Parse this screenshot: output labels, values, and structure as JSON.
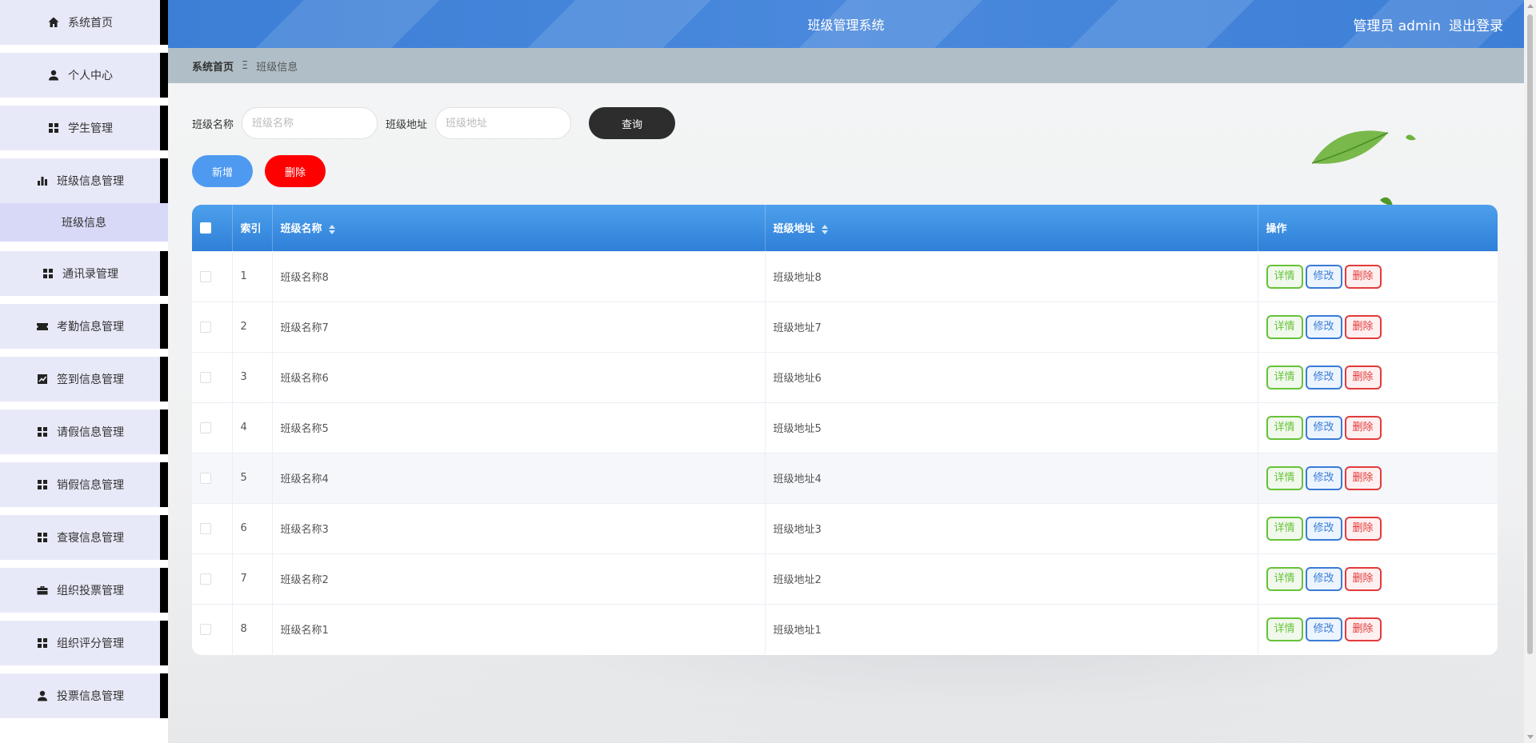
{
  "sidebar": {
    "items": [
      {
        "label": "系统首页",
        "icon": "home-icon"
      },
      {
        "label": "个人中心",
        "icon": "user-icon"
      },
      {
        "label": "学生管理",
        "icon": "grid-icon"
      },
      {
        "label": "班级信息管理",
        "icon": "bar-chart-icon"
      },
      {
        "label": "通讯录管理",
        "icon": "grid-icon"
      },
      {
        "label": "考勤信息管理",
        "icon": "ticket-icon"
      },
      {
        "label": "签到信息管理",
        "icon": "line-chart-icon"
      },
      {
        "label": "请假信息管理",
        "icon": "grid-icon"
      },
      {
        "label": "销假信息管理",
        "icon": "grid-icon"
      },
      {
        "label": "查寝信息管理",
        "icon": "grid-icon"
      },
      {
        "label": "组织投票管理",
        "icon": "briefcase-icon"
      },
      {
        "label": "组织评分管理",
        "icon": "grid-icon"
      },
      {
        "label": "投票信息管理",
        "icon": "user-icon"
      }
    ],
    "subitem": {
      "label": "班级信息"
    }
  },
  "header": {
    "title": "班级管理系统",
    "user": "管理员 admin",
    "logout": "退出登录"
  },
  "breadcrumb": {
    "home": "系统首页",
    "separator": "Ξ",
    "current": "班级信息"
  },
  "search": {
    "name_label": "班级名称",
    "name_placeholder": "班级名称",
    "address_label": "班级地址",
    "address_placeholder": "班级地址",
    "query_button": "查询"
  },
  "actions": {
    "add": "新增",
    "delete": "删除"
  },
  "table": {
    "columns": [
      "索引",
      "班级名称",
      "班级地址",
      "操作"
    ],
    "rows": [
      {
        "index": "1",
        "name": "班级名称8",
        "address": "班级地址8"
      },
      {
        "index": "2",
        "name": "班级名称7",
        "address": "班级地址7"
      },
      {
        "index": "3",
        "name": "班级名称6",
        "address": "班级地址6"
      },
      {
        "index": "4",
        "name": "班级名称5",
        "address": "班级地址5"
      },
      {
        "index": "5",
        "name": "班级名称4",
        "address": "班级地址4"
      },
      {
        "index": "6",
        "name": "班级名称3",
        "address": "班级地址3"
      },
      {
        "index": "7",
        "name": "班级名称2",
        "address": "班级地址2"
      },
      {
        "index": "8",
        "name": "班级名称1",
        "address": "班级地址1"
      }
    ],
    "ops": {
      "detail": "详情",
      "edit": "修改",
      "delete": "删除"
    }
  },
  "colors": {
    "header_blue": "#4a89dc",
    "add_blue": "#4e9af1",
    "delete_red": "#ff0000",
    "query_dark": "#2d2d2d",
    "sidebar_bg": "#e8e9f8"
  }
}
